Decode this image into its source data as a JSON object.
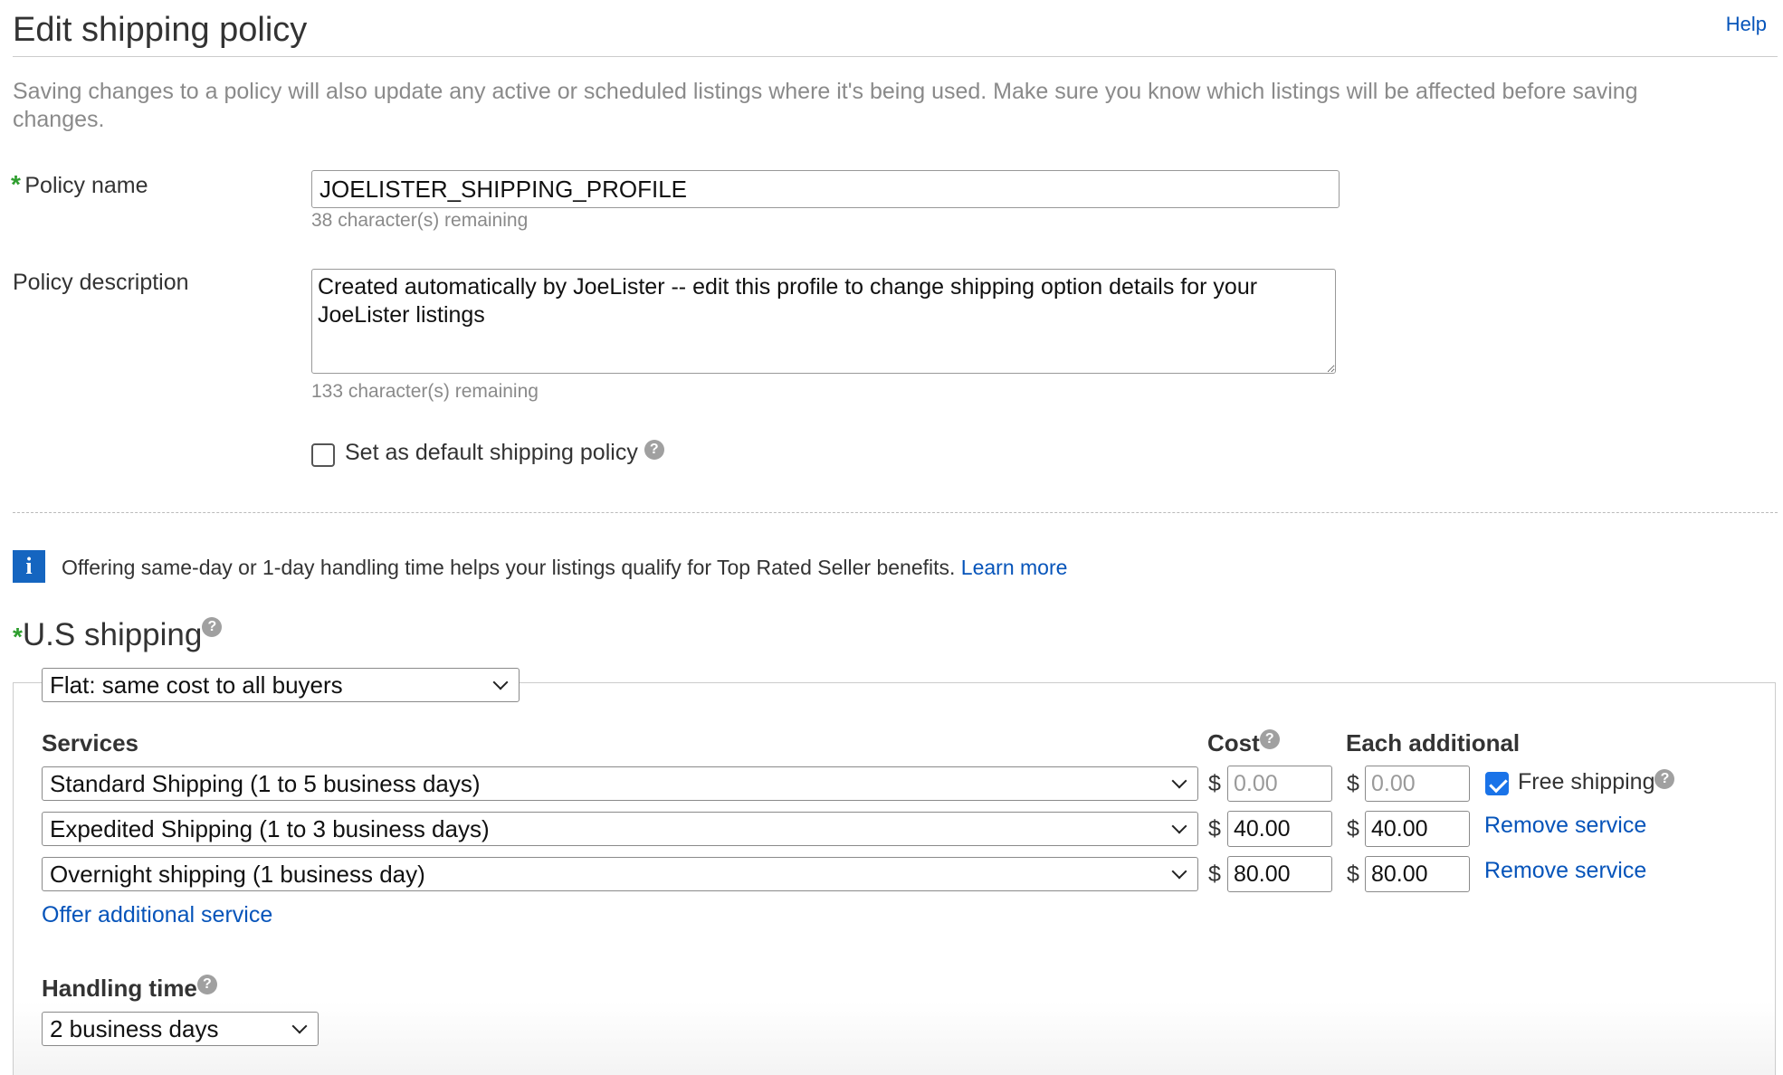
{
  "header": {
    "title": "Edit shipping policy",
    "help_label": "Help"
  },
  "notice": "Saving changes to a policy will also update any active or scheduled listings where it's being used. Make sure you know which listings will be affected before saving changes.",
  "policy_name": {
    "required_marker": "*",
    "label": "Policy name",
    "value": "JOELISTER_SHIPPING_PROFILE",
    "remaining": "38 character(s) remaining"
  },
  "policy_description": {
    "label": "Policy description",
    "value": "Created automatically by JoeLister -- edit this profile to change shipping option details for your JoeLister listings",
    "remaining": "133 character(s) remaining"
  },
  "default_policy": {
    "label": "Set as default shipping policy",
    "checked": false,
    "help": "?"
  },
  "info_banner": {
    "icon": "i",
    "text": "Offering same-day or 1-day handling time helps your listings qualify for Top Rated Seller benefits. ",
    "link": "Learn more"
  },
  "us_shipping": {
    "required_marker": "*",
    "title": "U.S shipping",
    "help": "?",
    "cost_type": "Flat: same cost to all buyers",
    "columns": {
      "services": "Services",
      "cost": "Cost",
      "each_additional": "Each additional"
    },
    "services": [
      {
        "name": "Standard Shipping (1 to 5 business days)",
        "cost": "0.00",
        "each_additional": "0.00",
        "action": "Free shipping"
      },
      {
        "name": "Expedited Shipping (1 to 3 business days)",
        "cost": "40.00",
        "each_additional": "40.00",
        "action": "Remove service"
      },
      {
        "name": "Overnight shipping (1 business day)",
        "cost": "80.00",
        "each_additional": "80.00",
        "action": "Remove service"
      }
    ],
    "currency_symbol": "$",
    "free_shipping_checked": true,
    "offer_additional": "Offer additional service",
    "handling_time": {
      "label": "Handling time",
      "value": "2 business days"
    }
  },
  "colors": {
    "link": "#0654ba",
    "required": "#2e9e2e",
    "info_icon": "#1565c0",
    "checkbox_checked": "#1a73e8"
  }
}
